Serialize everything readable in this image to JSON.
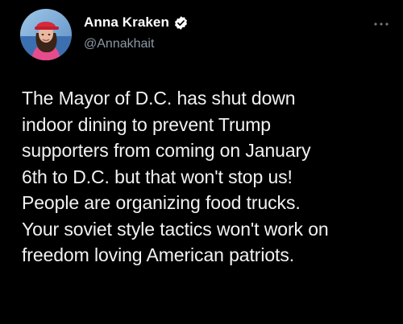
{
  "tweet": {
    "author": {
      "display_name": "Anna Kraken",
      "handle": "@Annakhait",
      "verified": true,
      "avatar_icon": "profile-photo"
    },
    "more_icon": "ellipsis-icon",
    "text": "The Mayor of D.C. has shut down\nindoor dining to prevent Trump\nsupporters from coming on January\n6th to D.C. but that won't stop us!\nPeople are organizing food trucks.\nYour soviet style tactics won't work on\nfreedom loving American patriots."
  },
  "colors": {
    "background": "#000000",
    "text": "#f2f2f2",
    "handle": "#8b98a5",
    "verified_badge": "#ffffff"
  }
}
